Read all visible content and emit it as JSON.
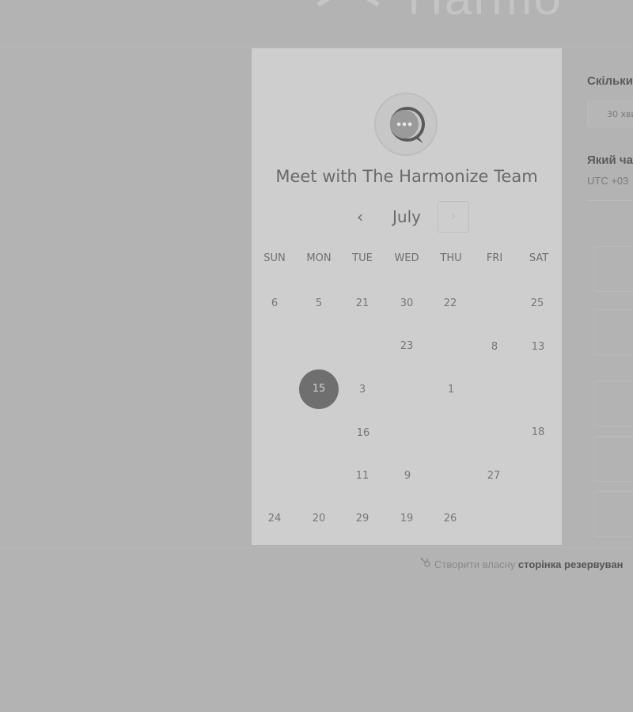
{
  "header": {
    "brand_text": "Harmo"
  },
  "card": {
    "host_title": "Meet with The Harmonize Team",
    "prev_label": "‹",
    "month": "July",
    "next_label": "›",
    "weekdays": [
      "SUN",
      "MON",
      "TUE",
      "WED",
      "THU",
      "FRI",
      "SAT"
    ],
    "days": [
      {
        "text": "6"
      },
      {
        "text": "5"
      },
      {
        "text": "21"
      },
      {
        "text": "30"
      },
      {
        "text": "22"
      },
      {
        "text": "25"
      },
      {
        "text": "23"
      },
      {
        "text": "8"
      },
      {
        "text": "13"
      },
      {
        "text": "15",
        "selected": true
      },
      {
        "text": "3"
      },
      {
        "text": "1"
      },
      {
        "text": "16"
      },
      {
        "text": "18"
      },
      {
        "text": "11"
      },
      {
        "text": "9"
      },
      {
        "text": "27"
      },
      {
        "text": "24"
      },
      {
        "text": "20"
      },
      {
        "text": "29"
      },
      {
        "text": "19"
      },
      {
        "text": "26"
      }
    ]
  },
  "side": {
    "duration_heading": "Скільки",
    "duration_value": "30 хви",
    "timezone_heading": "Який ча",
    "timezone_value": "UTC +03"
  },
  "footer": {
    "prefix": "Створити власну",
    "link": "сторінка резервуван"
  },
  "colors": {
    "background": "#b3b3b3",
    "card": "#cecece",
    "selected_day": "#6f6f6f"
  }
}
